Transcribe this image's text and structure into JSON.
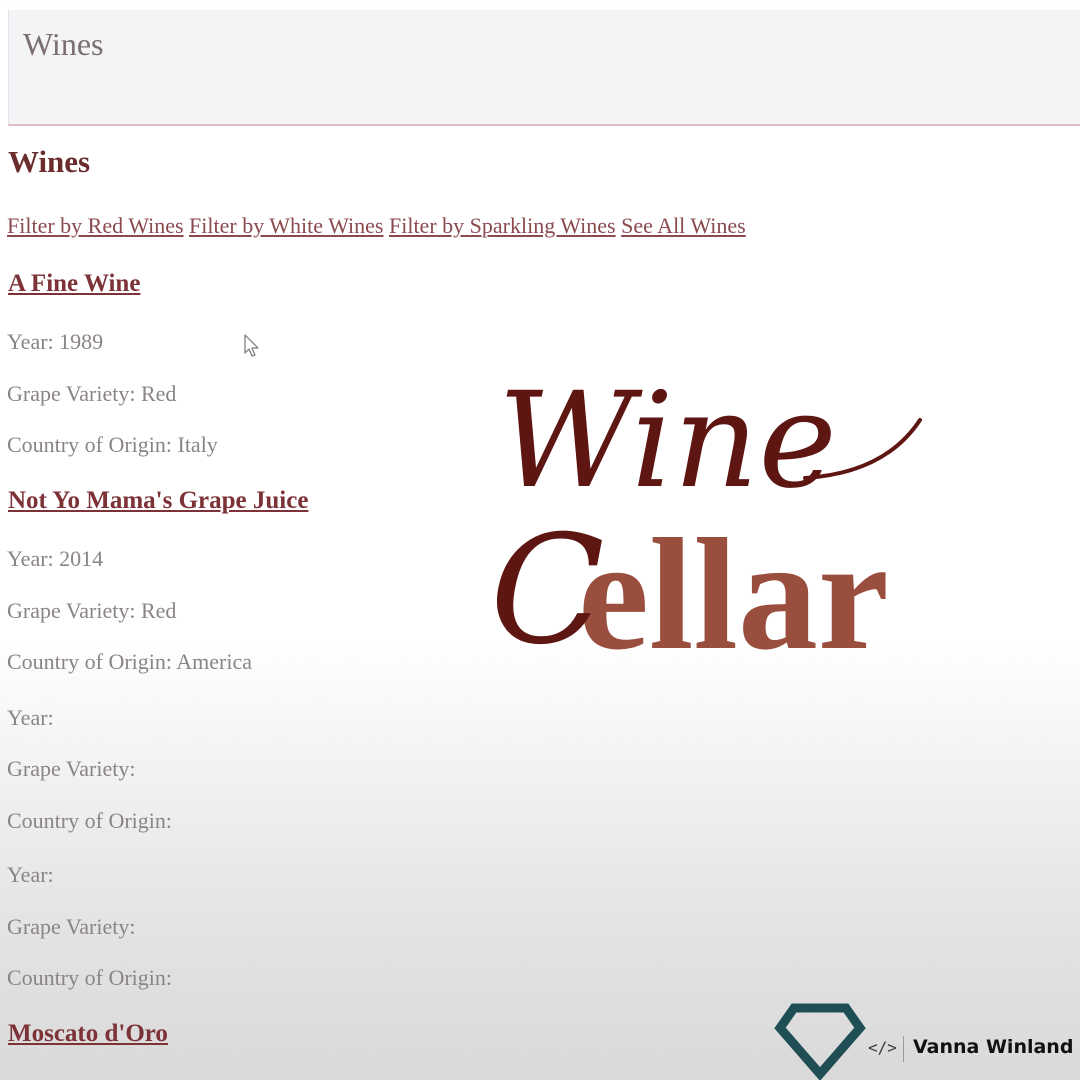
{
  "header": {
    "title": "Wines"
  },
  "page": {
    "heading": "Wines"
  },
  "filters": [
    "Filter by Red Wines",
    "Filter by White Wines",
    "Filter by Sparkling Wines",
    "See All Wines"
  ],
  "wines": [
    {
      "title": "A Fine Wine",
      "year": "Year: 1989",
      "grape": "Grape Variety: Red",
      "country": "Country of Origin: Italy"
    },
    {
      "title": "Not Yo Mama's Grape Juice",
      "year": "Year: 2014",
      "grape": "Grape Variety: Red",
      "country": "Country of Origin: America"
    },
    {
      "title": "",
      "year": "Year:",
      "grape": "Grape Variety:",
      "country": "Country of Origin:"
    },
    {
      "title": "",
      "year": "Year:",
      "grape": "Grape Variety:",
      "country": "Country of Origin:"
    },
    {
      "title": "Moscato d'Oro"
    }
  ],
  "logo": {
    "line1": "Wine",
    "line2_initial": "C",
    "line2_rest": "ellar"
  },
  "brand": {
    "icon": "diamond-logo-icon",
    "code_icon": "code-icon",
    "code_glyph": "</>",
    "name": "Vanna Winland"
  },
  "colors": {
    "wine_dark": "#5e1612",
    "wine_light": "#9a4e3e",
    "link": "#8a4a4e",
    "brand_teal": "#1f4f55"
  }
}
